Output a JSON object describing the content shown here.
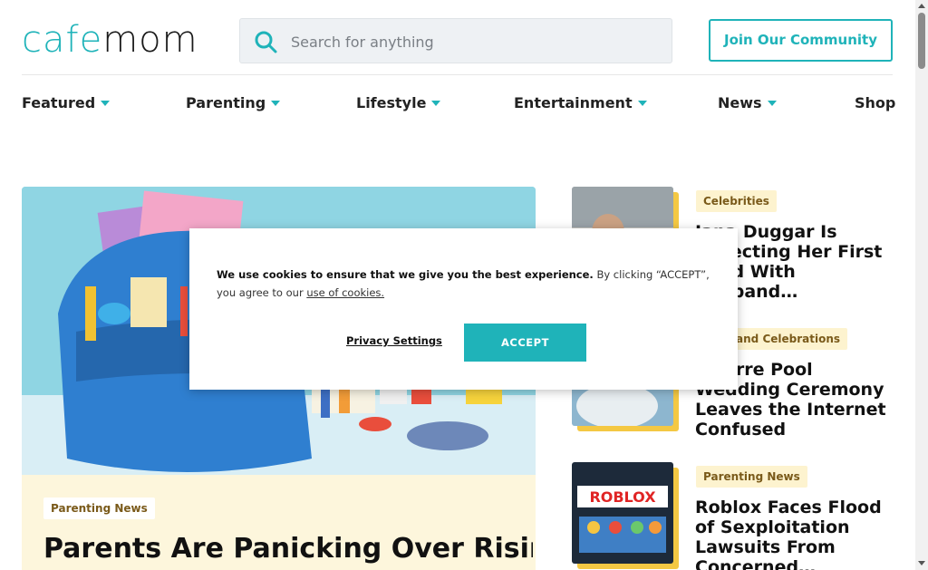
{
  "header": {
    "logo_part1": "cafe",
    "logo_part2": "mom",
    "search_placeholder": "Search for anything",
    "join_label": "Join Our Community"
  },
  "nav": {
    "items": [
      "Featured",
      "Parenting",
      "Lifestyle",
      "Entertainment",
      "News",
      "Shop"
    ]
  },
  "hero": {
    "category": "Parenting News",
    "title": "Parents Are Panicking Over Rising"
  },
  "sidebar": {
    "items": [
      {
        "category": "Celebrities",
        "title": "Jana Duggar Is Expecting Her First Child With Husband…"
      },
      {
        "category": "Love and Celebrations",
        "title": "Bizarre Pool Wedding Ceremony Leaves the Internet Confused"
      },
      {
        "category": "Parenting News",
        "title": "Roblox Faces Flood of Sexploitation Lawsuits From Concerned…"
      }
    ]
  },
  "cookie": {
    "bold_text": "We use cookies to ensure that we give you the best experience.",
    "text": " By clicking “ACCEPT”, you agree to our ",
    "link": "use of cookies.",
    "privacy_label": "Privacy Settings",
    "accept_label": "ACCEPT"
  },
  "thumb3": {
    "logo_text": "ROBLOX"
  },
  "colors": {
    "accent": "#1fb3b9",
    "badge_bg": "#fdf3cf",
    "shadow": "#f4c843",
    "hero_card": "#fdf6dc"
  }
}
